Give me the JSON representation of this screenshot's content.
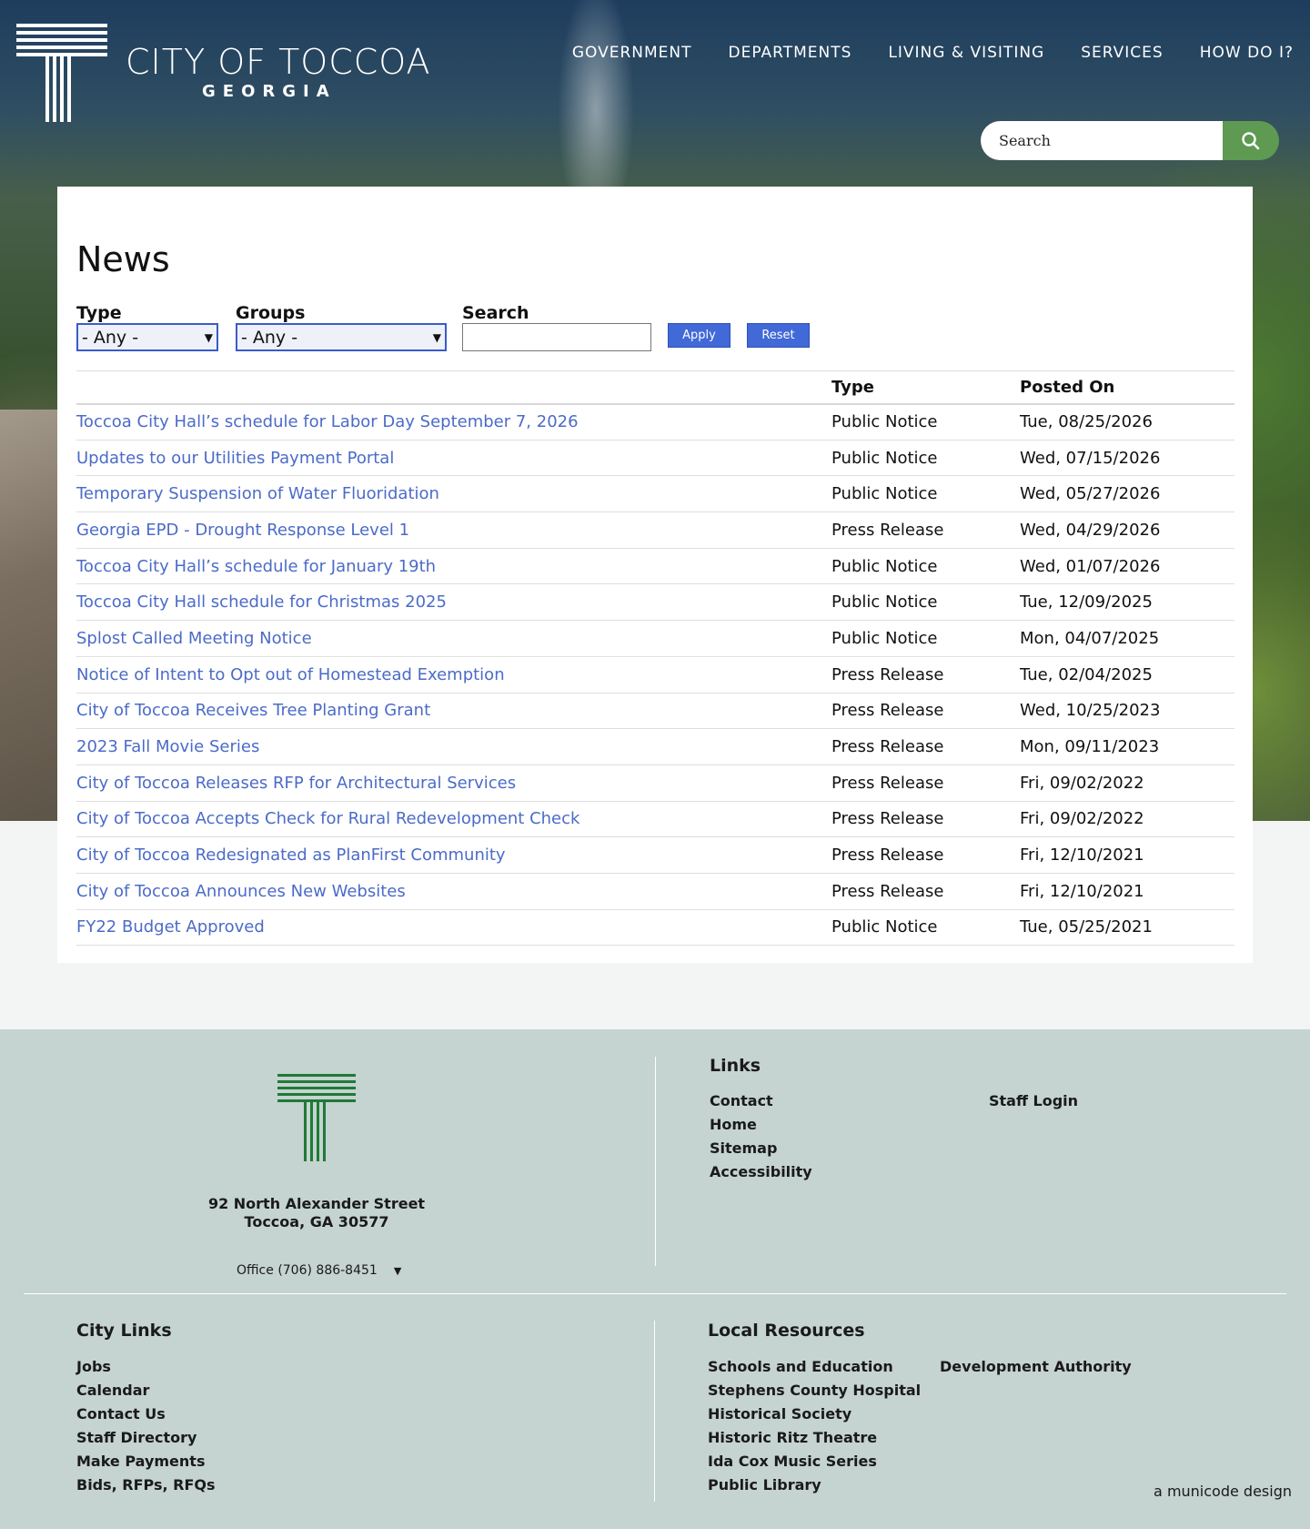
{
  "brand": {
    "title": "CITY OF TOCCOA",
    "subtitle": "GEORGIA"
  },
  "nav": [
    "GOVERNMENT",
    "DEPARTMENTS",
    "LIVING & VISITING",
    "SERVICES",
    "HOW DO I?"
  ],
  "header_search": {
    "placeholder": "Search"
  },
  "page": {
    "title": "News"
  },
  "filters": {
    "type_label": "Type",
    "type_value": "- Any -",
    "groups_label": "Groups",
    "groups_value": "- Any -",
    "search_label": "Search",
    "search_value": "",
    "apply_label": "Apply",
    "reset_label": "Reset"
  },
  "table": {
    "headers": [
      "",
      "Type",
      "Posted On"
    ],
    "rows": [
      {
        "title": "Toccoa City Hall’s schedule for Labor Day September 7, 2026",
        "type": "Public Notice",
        "date": "Tue, 08/25/2026"
      },
      {
        "title": "Updates to our Utilities Payment Portal",
        "type": "Public Notice",
        "date": "Wed, 07/15/2026"
      },
      {
        "title": "Temporary Suspension of Water Fluoridation",
        "type": "Public Notice",
        "date": "Wed, 05/27/2026"
      },
      {
        "title": "Georgia EPD - Drought Response Level 1",
        "type": "Press Release",
        "date": "Wed, 04/29/2026"
      },
      {
        "title": "Toccoa City Hall’s schedule for January 19th",
        "type": "Public Notice",
        "date": "Wed, 01/07/2026"
      },
      {
        "title": "Toccoa City Hall schedule for Christmas 2025",
        "type": "Public Notice",
        "date": "Tue, 12/09/2025"
      },
      {
        "title": "Splost Called Meeting Notice",
        "type": "Public Notice",
        "date": "Mon, 04/07/2025"
      },
      {
        "title": "Notice of Intent to Opt out of Homestead Exemption",
        "type": "Press Release",
        "date": "Tue, 02/04/2025"
      },
      {
        "title": "City of Toccoa Receives Tree Planting Grant",
        "type": "Press Release",
        "date": "Wed, 10/25/2023"
      },
      {
        "title": "2023 Fall Movie Series",
        "type": "Press Release",
        "date": "Mon, 09/11/2023"
      },
      {
        "title": "City of Toccoa Releases RFP for Architectural Services",
        "type": "Press Release",
        "date": "Fri, 09/02/2022"
      },
      {
        "title": "City of Toccoa Accepts Check for Rural Redevelopment Check",
        "type": "Press Release",
        "date": "Fri, 09/02/2022"
      },
      {
        "title": "City of Toccoa Redesignated as PlanFirst Community",
        "type": "Press Release",
        "date": "Fri, 12/10/2021"
      },
      {
        "title": "City of Toccoa Announces New Websites",
        "type": "Press Release",
        "date": "Fri, 12/10/2021"
      },
      {
        "title": "FY22 Budget Approved",
        "type": "Public Notice",
        "date": "Tue, 05/25/2021"
      }
    ]
  },
  "footer": {
    "address_line1": "92 North Alexander Street",
    "address_line2": "Toccoa, GA 30577",
    "office": "Office (706) 886-8451",
    "links_heading": "Links",
    "links_col1": [
      "Contact",
      "Home",
      "Sitemap",
      "Accessibility"
    ],
    "links_col2": [
      "Staff Login"
    ],
    "city_links_heading": "City Links",
    "city_links": [
      "Jobs",
      "Calendar",
      "Contact Us",
      "Staff Directory",
      "Make Payments",
      "Bids, RFPs, RFQs"
    ],
    "local_heading": "Local Resources",
    "local_col1": [
      "Schools and Education",
      "Stephens County Hospital",
      "Historical Society",
      "Historic Ritz Theatre",
      "Ida Cox Music Series",
      "Public Library"
    ],
    "local_col2": [
      "Development Authority"
    ],
    "credit": "a municode design"
  },
  "colors": {
    "link": "#4b6bc8",
    "button": "#4169d8",
    "search_button": "#5e9a52",
    "footer_bg": "#c5d3d1",
    "logo_green": "#1f7a35"
  }
}
